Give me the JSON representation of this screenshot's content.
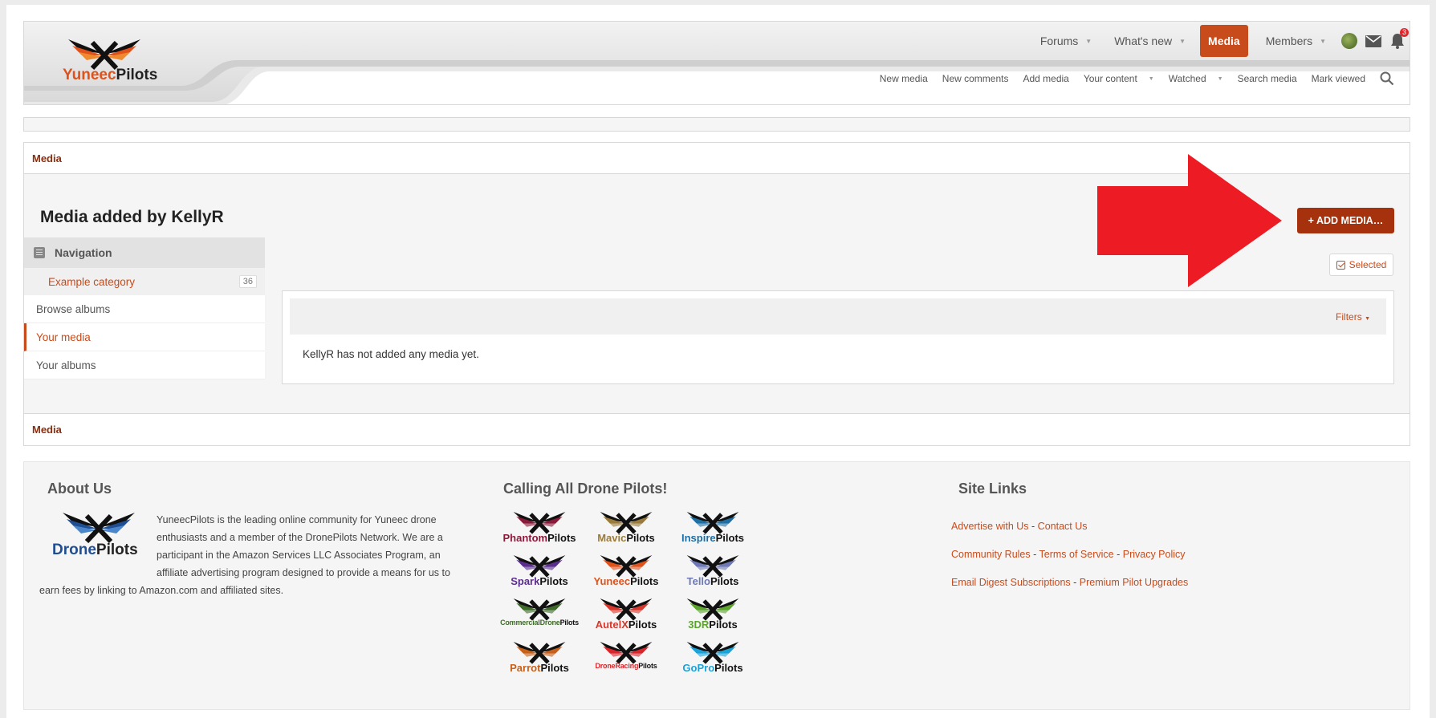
{
  "header": {
    "logo": {
      "part1": "Yuneec",
      "part2": "Pilots"
    },
    "topnav": [
      {
        "label": "Forums",
        "caret": true
      },
      {
        "label": "What's new",
        "caret": true
      },
      {
        "label": "Media",
        "caret": false,
        "active": true
      },
      {
        "label": "Members",
        "caret": true
      }
    ],
    "notification_count": "3",
    "subnav": [
      {
        "label": "New media",
        "caret": false
      },
      {
        "label": "New comments",
        "caret": false
      },
      {
        "label": "Add media",
        "caret": false
      },
      {
        "label": "Your content",
        "caret": true
      },
      {
        "label": "Watched",
        "caret": true
      },
      {
        "label": "Search media",
        "caret": false
      },
      {
        "label": "Mark viewed",
        "caret": false
      }
    ]
  },
  "breadcrumb": "Media",
  "page_title": "Media added by KellyR",
  "sidebar": {
    "heading": "Navigation",
    "category": {
      "label": "Example category",
      "count": "36"
    },
    "links": [
      {
        "label": "Browse albums",
        "active": false
      },
      {
        "label": "Your media",
        "active": true
      },
      {
        "label": "Your albums",
        "active": false
      }
    ]
  },
  "actions": {
    "add_media": "+ ADD MEDIA…",
    "selected": "Selected"
  },
  "list": {
    "filters": "Filters",
    "empty_message": "KellyR has not added any media yet."
  },
  "footer": {
    "about": {
      "heading": "About Us",
      "logo_word": {
        "part1": "Drone",
        "part2": "Pilots"
      },
      "text": "YuneecPilots is the leading online community for Yuneec drone enthusiasts and a member of the DronePilots Network. We are a participant in the Amazon Services LLC Associates Program, an affiliate advertising program designed to provide a means for us to earn fees by linking to Amazon.com and affiliated sites."
    },
    "calling": {
      "heading": "Calling All Drone Pilots!",
      "sites": [
        {
          "part1": "Phantom",
          "part2": "Pilots",
          "color": "#8b1a3a"
        },
        {
          "part1": "Mavic",
          "part2": "Pilots",
          "color": "#9a7b3a"
        },
        {
          "part1": "Inspire",
          "part2": "Pilots",
          "color": "#1d6fa5"
        },
        {
          "part1": "Spark",
          "part2": "Pilots",
          "color": "#5b2d8f"
        },
        {
          "part1": "Yuneec",
          "part2": "Pilots",
          "color": "#e0521a"
        },
        {
          "part1": "Tello",
          "part2": "Pilots",
          "color": "#6d79b5"
        },
        {
          "part1": "CommercialDrone",
          "part2": "Pilots",
          "color": "#3f6b2a",
          "small": true
        },
        {
          "part1": "AutelX",
          "part2": "Pilots",
          "color": "#d9362b"
        },
        {
          "part1": "3DR",
          "part2": "Pilots",
          "color": "#5ca52d"
        },
        {
          "part1": "Parrot",
          "part2": "Pilots",
          "color": "#c8601a"
        },
        {
          "part1": "DroneRacing",
          "part2": "Pilots",
          "color": "#d9252b",
          "small": true
        },
        {
          "part1": "GoPro",
          "part2": "Pilots",
          "color": "#1aa3d9"
        }
      ]
    },
    "site_links": {
      "heading": "Site Links",
      "rows": [
        [
          "Advertise with Us",
          "Contact Us"
        ],
        [
          "Community Rules",
          "Terms of Service",
          "Privacy Policy"
        ],
        [
          "Email Digest Subscriptions",
          "Premium Pilot Upgrades"
        ]
      ]
    }
  },
  "colors": {
    "accent": "#c84b1b",
    "button": "#a6320d",
    "annotation_arrow": "#ed1c24"
  }
}
